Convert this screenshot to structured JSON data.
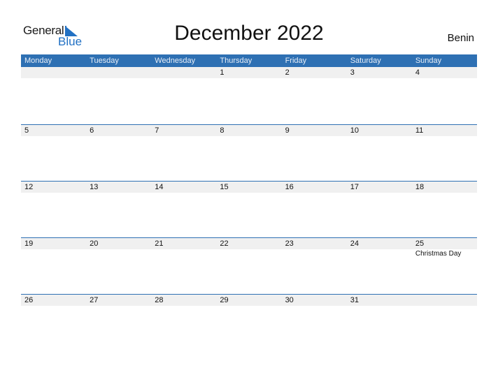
{
  "logo": {
    "line1": "General",
    "line2": "Blue"
  },
  "title": "December 2022",
  "country": "Benin",
  "weekdays": [
    "Monday",
    "Tuesday",
    "Wednesday",
    "Thursday",
    "Friday",
    "Saturday",
    "Sunday"
  ],
  "weeks": [
    {
      "days": [
        "",
        "",
        "",
        "1",
        "2",
        "3",
        "4"
      ],
      "events": [
        "",
        "",
        "",
        "",
        "",
        "",
        ""
      ]
    },
    {
      "days": [
        "5",
        "6",
        "7",
        "8",
        "9",
        "10",
        "11"
      ],
      "events": [
        "",
        "",
        "",
        "",
        "",
        "",
        ""
      ]
    },
    {
      "days": [
        "12",
        "13",
        "14",
        "15",
        "16",
        "17",
        "18"
      ],
      "events": [
        "",
        "",
        "",
        "",
        "",
        "",
        ""
      ]
    },
    {
      "days": [
        "19",
        "20",
        "21",
        "22",
        "23",
        "24",
        "25"
      ],
      "events": [
        "",
        "",
        "",
        "",
        "",
        "",
        "Christmas Day"
      ]
    },
    {
      "days": [
        "26",
        "27",
        "28",
        "29",
        "30",
        "31",
        ""
      ],
      "events": [
        "",
        "",
        "",
        "",
        "",
        "",
        ""
      ]
    }
  ],
  "colors": {
    "accent": "#2e70b3",
    "logo_blue": "#2271c4",
    "day_row_bg": "#f0f0f0"
  }
}
